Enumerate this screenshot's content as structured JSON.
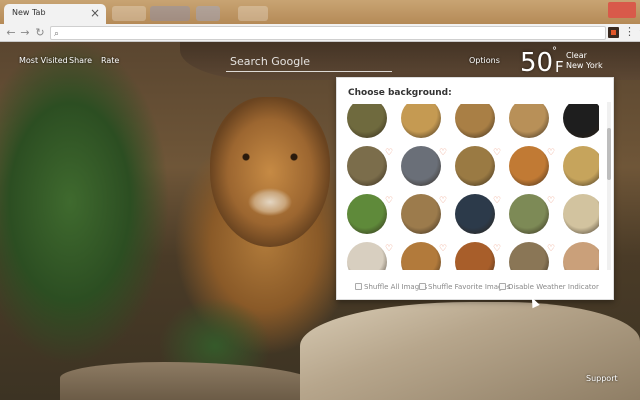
{
  "browser": {
    "tab_title": "New Tab",
    "tab_close": "×",
    "back_glyph": "←",
    "forward_glyph": "→",
    "reload_glyph": "↻",
    "omnibox_value": "",
    "star_glyph": "☆",
    "menu_glyph": "⋮"
  },
  "topnav": {
    "most_visited": "Most Visited",
    "share": "Share",
    "rate": "Rate",
    "options": "Options"
  },
  "search": {
    "placeholder": "Search Google"
  },
  "weather": {
    "temperature": "50",
    "degree_symbol": "°",
    "unit": "F",
    "condition": "Clear",
    "city": "New York"
  },
  "panel": {
    "title": "Choose background:",
    "heart_glyph": "♡",
    "options": {
      "shuffle_all": "Shuffle All Images",
      "shuffle_favorite": "Shuffle Favorite Images",
      "disable_weather": "Disable Weather Indicator"
    }
  },
  "thumb_colors": [
    [
      "#6f6a3e",
      "#c59a52",
      "#a97f45",
      "#b89058",
      "#1e1e1e"
    ],
    [
      "#7b6d4b",
      "#6a6f78",
      "#9a7a43",
      "#c17a34",
      "#c6a45c"
    ],
    [
      "#5f8a3a",
      "#9c7b4c",
      "#2c3a4a",
      "#7d8a56",
      "#d2c39f"
    ],
    [
      "#d8cfc0",
      "#b27a3b",
      "#a85e2a",
      "#8a7656",
      "#caa07a"
    ]
  ],
  "support": "Support",
  "colors": {
    "accent_heart": "#e98a6b",
    "panel_bg": "#ffffff"
  }
}
